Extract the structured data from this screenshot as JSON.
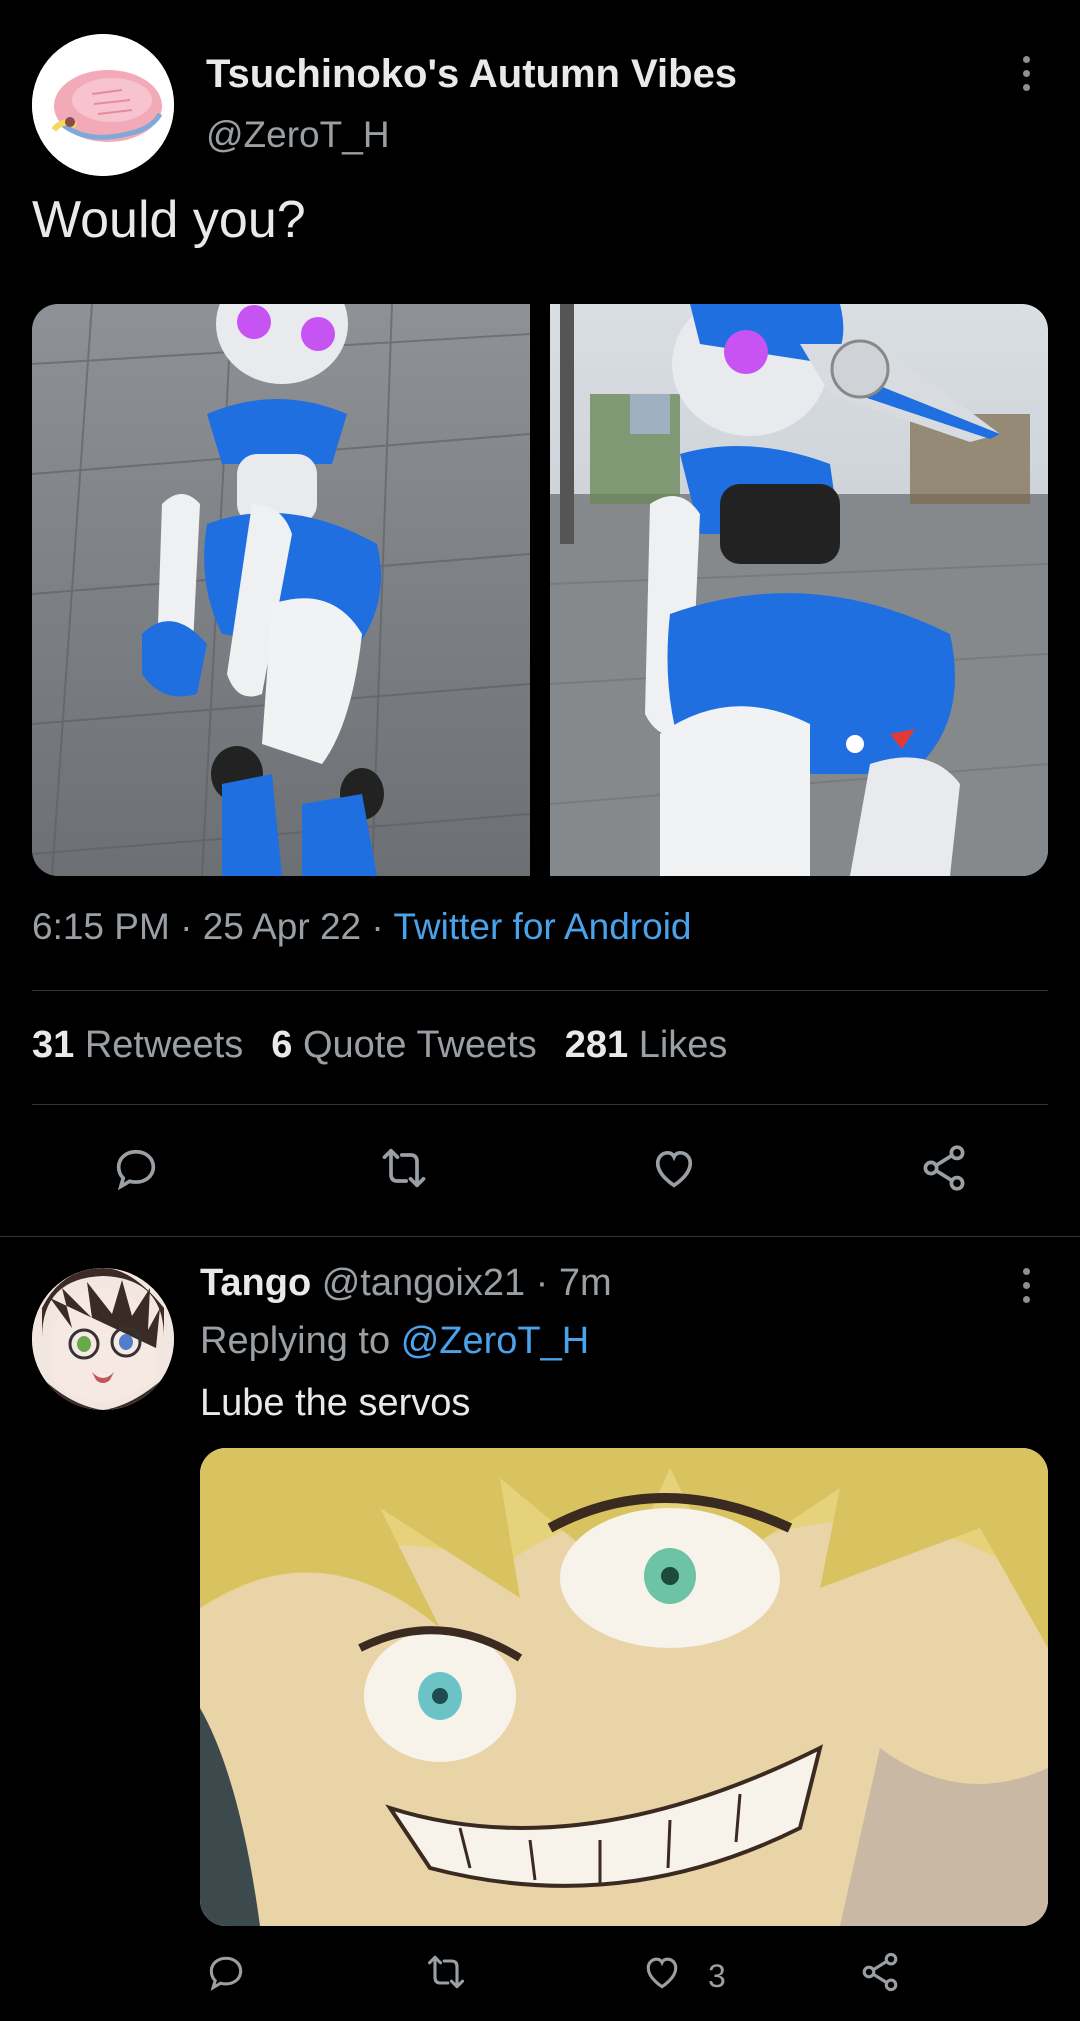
{
  "tweet": {
    "author_name": "Tsuchinoko's Autumn Vibes",
    "author_handle": "@ZeroT_H",
    "text": "Would you?",
    "time": "6:15 PM",
    "date": "25 Apr 22",
    "separator": " · ",
    "source": "Twitter for Android",
    "stats": {
      "retweets_count": "31",
      "retweets_label": "Retweets",
      "quotes_count": "6",
      "quotes_label": "Quote Tweets",
      "likes_count": "281",
      "likes_label": "Likes"
    },
    "actions": [
      "reply-icon",
      "retweet-icon",
      "like-icon",
      "share-icon"
    ]
  },
  "reply": {
    "author_name": "Tango",
    "author_handle": "@tangoix21",
    "time_ago": "7m",
    "separator": " · ",
    "replying_prefix": "Replying to",
    "replying_to": "@ZeroT_H",
    "text": "Lube the servos",
    "like_count": "3",
    "actions": [
      "reply-icon",
      "retweet-icon",
      "like-icon",
      "share-icon"
    ]
  },
  "colors": {
    "background": "#000000",
    "primary_text": "#e7e9ea",
    "secondary_text": "#9a9fa4",
    "link": "#4aa2eb",
    "divider": "#2f3336",
    "robot_blue": "#1f6fe0"
  }
}
